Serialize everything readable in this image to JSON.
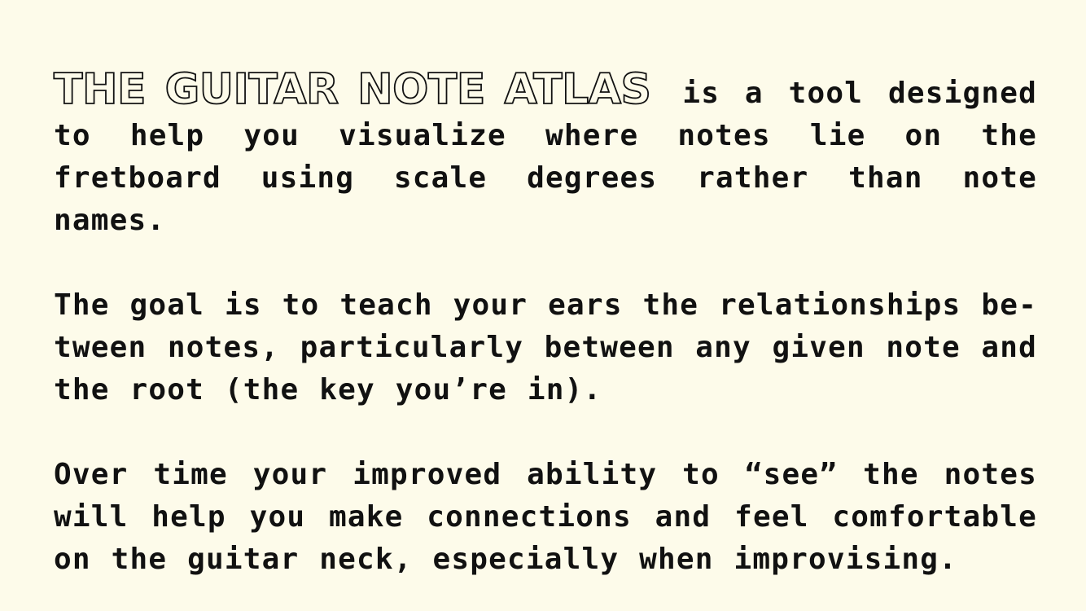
{
  "intro": {
    "title": "THE GUITAR NOTE ATLAS",
    "text": "is a tool designed to help you visualize where notes lie on the fretboard using scale degrees rather than note names."
  },
  "paragraphs": [
    "The goal is to teach your ears the relationships be-tween notes, particularly between any given note and the root (the key you’re in).",
    "Over time your improved ability to “see” the notes will help you make connections and feel comfortable on the guitar neck, especially when improvising."
  ]
}
